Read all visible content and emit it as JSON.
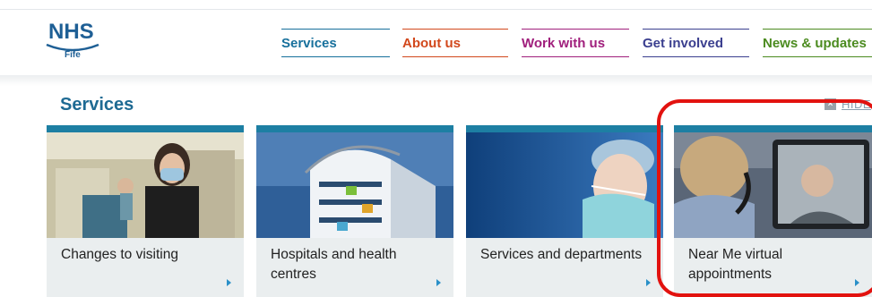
{
  "logo": {
    "brand": "NHS",
    "region": "Fife"
  },
  "nav": {
    "services": "Services",
    "about": "About us",
    "work": "Work with us",
    "involved": "Get involved",
    "news": "News & updates"
  },
  "section": {
    "title": "Services",
    "hide_label": "HIDE"
  },
  "cards": [
    {
      "label": "Changes to visiting"
    },
    {
      "label": "Hospitals and health centres"
    },
    {
      "label": "Services and departments"
    },
    {
      "label": "Near Me virtual appointments"
    }
  ],
  "colors": {
    "brand_blue": "#1e5f95",
    "nav_services": "#17709c",
    "nav_about": "#d2481c",
    "nav_work": "#a01f7c",
    "nav_involved": "#3b3f8f",
    "nav_news": "#4b8b1f",
    "card_bar": "#1d7fa3",
    "highlight": "#e2120f"
  }
}
